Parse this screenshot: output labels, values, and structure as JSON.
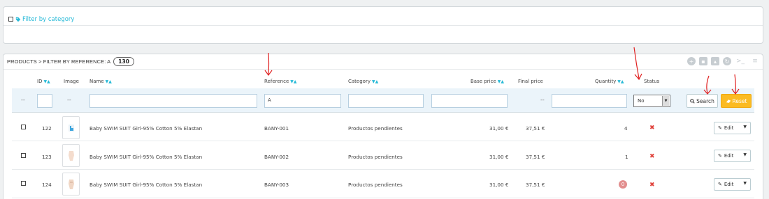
{
  "filter_panel": {
    "label": "Filter by category"
  },
  "products_panel": {
    "title": "PRODUCTS > FILTER BY REFERENCE: A",
    "count": "130"
  },
  "columns": {
    "id": "ID",
    "image": "Image",
    "name": "Name",
    "reference": "Reference",
    "category": "Category",
    "base_price": "Base price",
    "final_price": "Final price",
    "quantity": "Quantity",
    "status": "Status"
  },
  "filters": {
    "dash": "--",
    "reference_value": "A",
    "status_value": "No",
    "search_label": "Search",
    "reset_label": "Reset"
  },
  "rows": [
    {
      "id": "122",
      "name": "Baby SWIM SUIT Girl-95% Cotton 5% Elastan",
      "reference": "BANY-001",
      "category": "Productos pendientes",
      "base_price": "31,00 €",
      "final_price": "37,51 €",
      "quantity": "4",
      "edit": "Edit"
    },
    {
      "id": "123",
      "name": "Baby SWIM SUIT Girl-95% Cotton 5% Elastan",
      "reference": "BANY-002",
      "category": "Productos pendientes",
      "base_price": "31,00 €",
      "final_price": "37,51 €",
      "quantity": "1",
      "edit": "Edit"
    },
    {
      "id": "124",
      "name": "Baby SWIM SUIT Girl-95% Cotton 5% Elastan",
      "reference": "BANY-003",
      "category": "Productos pendientes",
      "base_price": "31,00 €",
      "final_price": "37,51 €",
      "quantity": "0",
      "edit": "Edit"
    }
  ],
  "colors": {
    "accent": "#25b9d7",
    "reset": "#fbbb22",
    "danger": "#e0433c",
    "annotation": "#e02020"
  }
}
